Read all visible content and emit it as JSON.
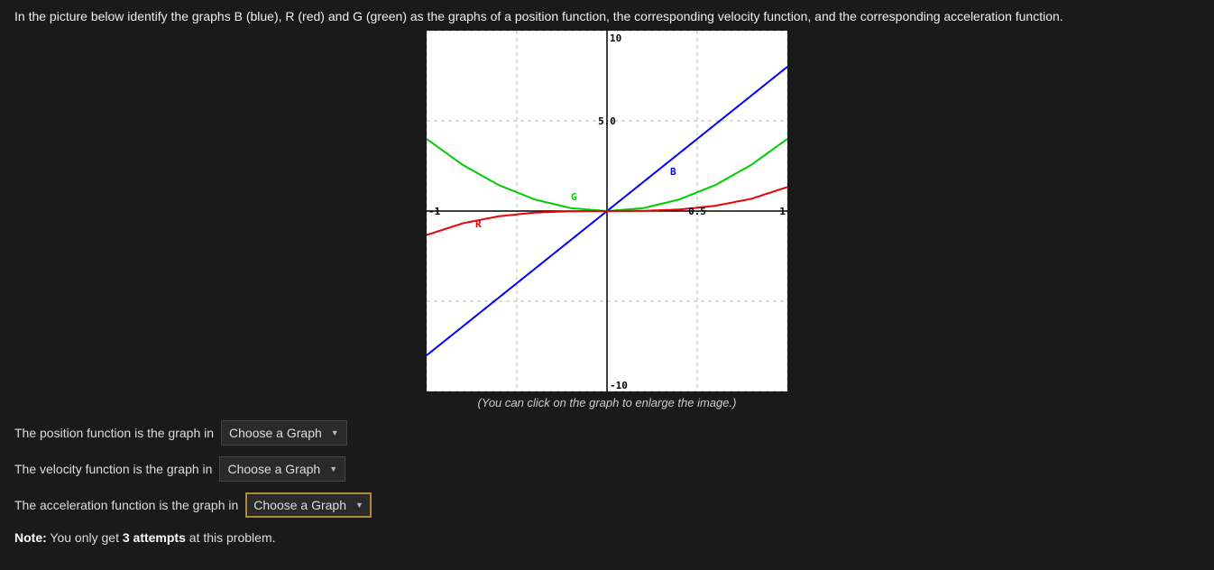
{
  "prompt_text": "In the picture below identify the graphs B (blue), R (red) and G (green) as the graphs of a position function, the corresponding velocity function, and the corresponding acceleration function.",
  "caption": "(You can click on the graph to enlarge the image.)",
  "questions": {
    "position": {
      "label": "The position function is the graph in",
      "selected": "Choose a Graph"
    },
    "velocity": {
      "label": "The velocity function is the graph in",
      "selected": "Choose a Graph"
    },
    "acceleration": {
      "label": "The acceleration function is the graph in",
      "selected": "Choose a Graph"
    }
  },
  "note": {
    "prefix": "Note:",
    "body": " You only get ",
    "attempts": "3 attempts",
    "suffix": " at this problem."
  },
  "chart_data": {
    "type": "line",
    "xlim": [
      -1,
      1
    ],
    "ylim": [
      -10,
      10
    ],
    "xticks": [
      -1,
      -0.5,
      0,
      0.5,
      1
    ],
    "yticks": [
      -10,
      -5,
      0,
      5,
      10
    ],
    "xtick_labels": [
      "-1",
      "",
      "",
      "0.5",
      "1"
    ],
    "ytick_labels": [
      "-10",
      "",
      "",
      "5.0",
      "10"
    ],
    "series": [
      {
        "name": "B",
        "color": "#0000ff",
        "label_pos": {
          "x": 0.35,
          "y": 2.0
        },
        "x": [
          -1.0,
          -0.8,
          -0.6,
          -0.4,
          -0.2,
          0.0,
          0.2,
          0.4,
          0.6,
          0.8,
          1.0
        ],
        "y": [
          -8.0,
          -6.4,
          -4.8,
          -3.2,
          -1.6,
          0.0,
          1.6,
          3.2,
          4.8,
          6.4,
          8.0
        ]
      },
      {
        "name": "G",
        "color": "#00cc00",
        "label_pos": {
          "x": -0.2,
          "y": 0.6
        },
        "x": [
          -1.0,
          -0.8,
          -0.6,
          -0.4,
          -0.2,
          0.0,
          0.2,
          0.4,
          0.6,
          0.8,
          1.0
        ],
        "y": [
          4.0,
          2.56,
          1.44,
          0.64,
          0.16,
          0.0,
          0.16,
          0.64,
          1.44,
          2.56,
          4.0
        ]
      },
      {
        "name": "R",
        "color": "#ee0000",
        "label_pos": {
          "x": -0.73,
          "y": -0.9
        },
        "x": [
          -1.0,
          -0.8,
          -0.6,
          -0.4,
          -0.2,
          0.0,
          0.2,
          0.4,
          0.6,
          0.8,
          1.0
        ],
        "y": [
          -1.33,
          -0.68,
          -0.29,
          -0.085,
          -0.011,
          0.0,
          0.011,
          0.085,
          0.29,
          0.68,
          1.33
        ]
      }
    ]
  }
}
